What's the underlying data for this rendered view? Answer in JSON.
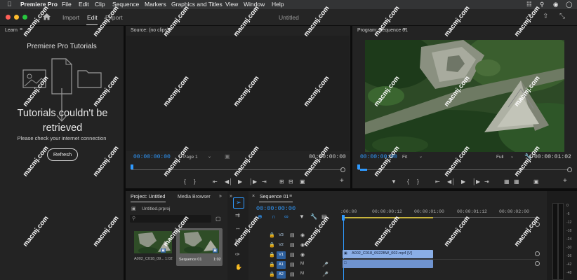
{
  "menubar": {
    "app": "Premiere Pro",
    "items": [
      "File",
      "Edit",
      "Clip",
      "Sequence",
      "Markers",
      "Graphics and Titles",
      "View",
      "Window",
      "Help"
    ]
  },
  "titlebar": {
    "import": "Import",
    "edit": "Edit",
    "export": "Export",
    "doc_title": "Untitled"
  },
  "learn": {
    "header": "Learn",
    "tutorials": "Premiere Pro Tutorials",
    "error_title": "Tutorials couldn't be retrieved",
    "error_msg": "Please check your internet connection",
    "refresh": "Refresh"
  },
  "source": {
    "header": "Source: (no clips)",
    "tc_left": "00:00:00:00",
    "page": "Page 1",
    "tc_right": "00:00:00:00"
  },
  "program": {
    "header": "Program: Sequence 01",
    "tc_left": "00:00:00:00",
    "fit": "Fit",
    "full": "Full",
    "tc_right": "00:00:01:02"
  },
  "project": {
    "tab_project": "Project: Untitled",
    "tab_media": "Media Browser",
    "file": "Untitled.prproj",
    "items": [
      {
        "name": "A002_C018_09...",
        "duration": "1:02"
      },
      {
        "name": "Sequence 01",
        "duration": "1:02"
      }
    ]
  },
  "timeline": {
    "tab": "Sequence 01",
    "tc": "00:00:00:00",
    "ruler": [
      ":00:00",
      "00:00:00:12",
      "00:00:01:00",
      "00:00:01:12",
      "00:00:02:00"
    ],
    "tracks": [
      {
        "name": "V3",
        "on": false
      },
      {
        "name": "V2",
        "on": false
      },
      {
        "name": "V1",
        "on": true
      },
      {
        "name": "A1",
        "on": true
      },
      {
        "name": "A2",
        "on": true
      }
    ],
    "clip_video": "A002_C018_0922BW_002.mp4 [V]"
  },
  "meter": {
    "labels": [
      "0",
      "-6",
      "-12",
      "-18",
      "-24",
      "-30",
      "-36",
      "-42",
      "-48"
    ]
  },
  "watermark": "macmj.com",
  "colors": {
    "accent": "#2f9aff",
    "clip": "#8aaee6",
    "track_on": "#2c5f9e"
  }
}
